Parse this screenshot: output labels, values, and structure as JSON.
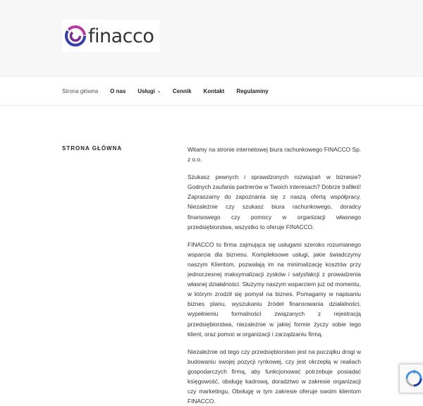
{
  "brand": {
    "name": "finacco",
    "colors": {
      "logo_purple": "#7a2a92",
      "logo_blue": "#3a3fa8",
      "logo_magenta": "#b43ca0"
    }
  },
  "nav": {
    "items": [
      {
        "label": "Strona główna",
        "current": true
      },
      {
        "label": "O nas"
      },
      {
        "label": "Usługi",
        "has_dropdown": true
      },
      {
        "label": "Cennik"
      },
      {
        "label": "Kontakt"
      },
      {
        "label": "Regulaminy"
      }
    ],
    "dropdown_icon": "chevron-down-icon"
  },
  "page": {
    "title": "Strona główna"
  },
  "content": {
    "paragraphs": [
      "Witamy na stronie internetowej biura rachunkowego FINACCO Sp. z o.o.",
      "Szukasz pewnych i sprawdzonych rozwiązań w biznesie? Godnych zaufania partnerów w Twoich interesach? Dobrze trafiłeś! Zapraszamy do zapoznania się z naszą ofertą współpracy. Niezależnie czy szukasz biura rachunkowego, doradcy finansowego czy pomocy w organizacji własnego przedsiębiorstwa, wszystko to oferuje FINACCO.",
      "FINACCO to firma zajmująca się usługami szeroko rozumianego wsparcia dla biznesu. Kompleksowe usługi, jakie świadczymy naszym Klientom, pozwalają im na minimalizację kosztów przy jednoczesnej maksymalizacji zysków i satysfakcji z prowadzenia własnej działalności. Służymy naszym wsparciem już od momentu, w którym zrodził się pomysł na biznes. Pomagamy w napisaniu biznes planu, wyszukaniu źródeł finansowania działalności, wypełnieniu formalności związanych z rejestracją przedsiębiorstwa, niezależnie w jakiej formie życzy sobie tego klient, oraz pomoc w organizacji i zarządzaniu firmą.",
      "Niezależnie od tego czy przedsiębiorstwo jest na początku drogi w budowaniu swojej pozycji rynkowej, czy jest okrzepłą w realiach gospodarczych firmą, aby funkcjonować potrzebuje posiadać księgowość, obsługę kadrową, doradztwo w zakresie organizacji czy marketingu. Obsługę w tym zakresie oferuje swoim klientom FINACCO."
    ]
  },
  "recaptcha": {
    "icon": "recaptcha-icon"
  }
}
